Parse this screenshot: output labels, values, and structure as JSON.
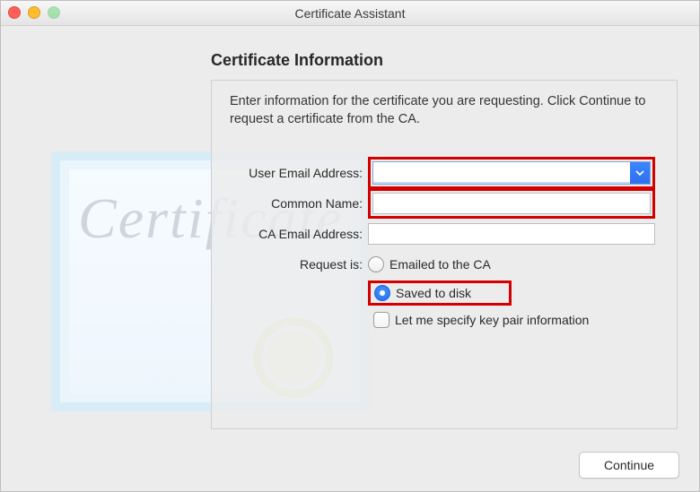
{
  "window": {
    "title": "Certificate Assistant"
  },
  "heading": "Certificate Information",
  "instructions": "Enter information for the certificate you are requesting. Click Continue to request a certificate from the CA.",
  "form": {
    "user_email": {
      "label": "User Email Address:",
      "value": ""
    },
    "common_name": {
      "label": "Common Name:",
      "value": ""
    },
    "ca_email": {
      "label": "CA Email Address:",
      "value": ""
    },
    "request_is": {
      "label": "Request is:",
      "options": {
        "emailed": "Emailed to the CA",
        "saved": "Saved to disk"
      },
      "selected": "saved"
    },
    "specify_keypair": {
      "label": "Let me specify key pair information",
      "checked": false
    }
  },
  "buttons": {
    "continue": "Continue"
  },
  "decor": {
    "script_word": "Certificate"
  }
}
